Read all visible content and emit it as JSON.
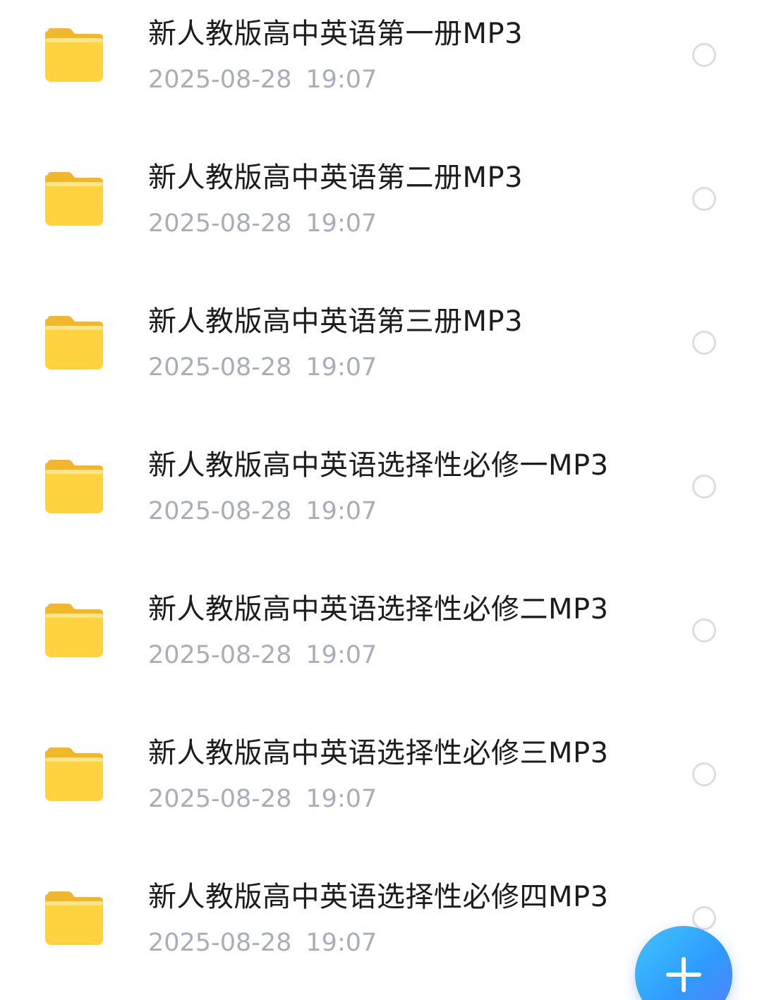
{
  "files": [
    {
      "name": "新人教版高中英语第一册MP3",
      "date": "2025-08-28",
      "time": "19:07",
      "icon": "folder-icon"
    },
    {
      "name": "新人教版高中英语第二册MP3",
      "date": "2025-08-28",
      "time": "19:07",
      "icon": "folder-icon"
    },
    {
      "name": "新人教版高中英语第三册MP3",
      "date": "2025-08-28",
      "time": "19:07",
      "icon": "folder-icon"
    },
    {
      "name": "新人教版高中英语选择性必修一MP3",
      "date": "2025-08-28",
      "time": "19:07",
      "icon": "folder-icon"
    },
    {
      "name": "新人教版高中英语选择性必修二MP3",
      "date": "2025-08-28",
      "time": "19:07",
      "icon": "folder-icon"
    },
    {
      "name": "新人教版高中英语选择性必修三MP3",
      "date": "2025-08-28",
      "time": "19:07",
      "icon": "folder-icon"
    },
    {
      "name": "新人教版高中英语选择性必修四MP3",
      "date": "2025-08-28",
      "time": "19:07",
      "icon": "folder-icon"
    }
  ],
  "fab": {
    "icon": "plus-icon"
  },
  "colors": {
    "folder": "#FFD23F",
    "folder_tab": "#F7BE2A",
    "title_text": "#1C1C1E",
    "meta_text": "#A9ADB8",
    "radio_border": "#DCDDE0",
    "fab_accent": "#2F9BFF"
  }
}
